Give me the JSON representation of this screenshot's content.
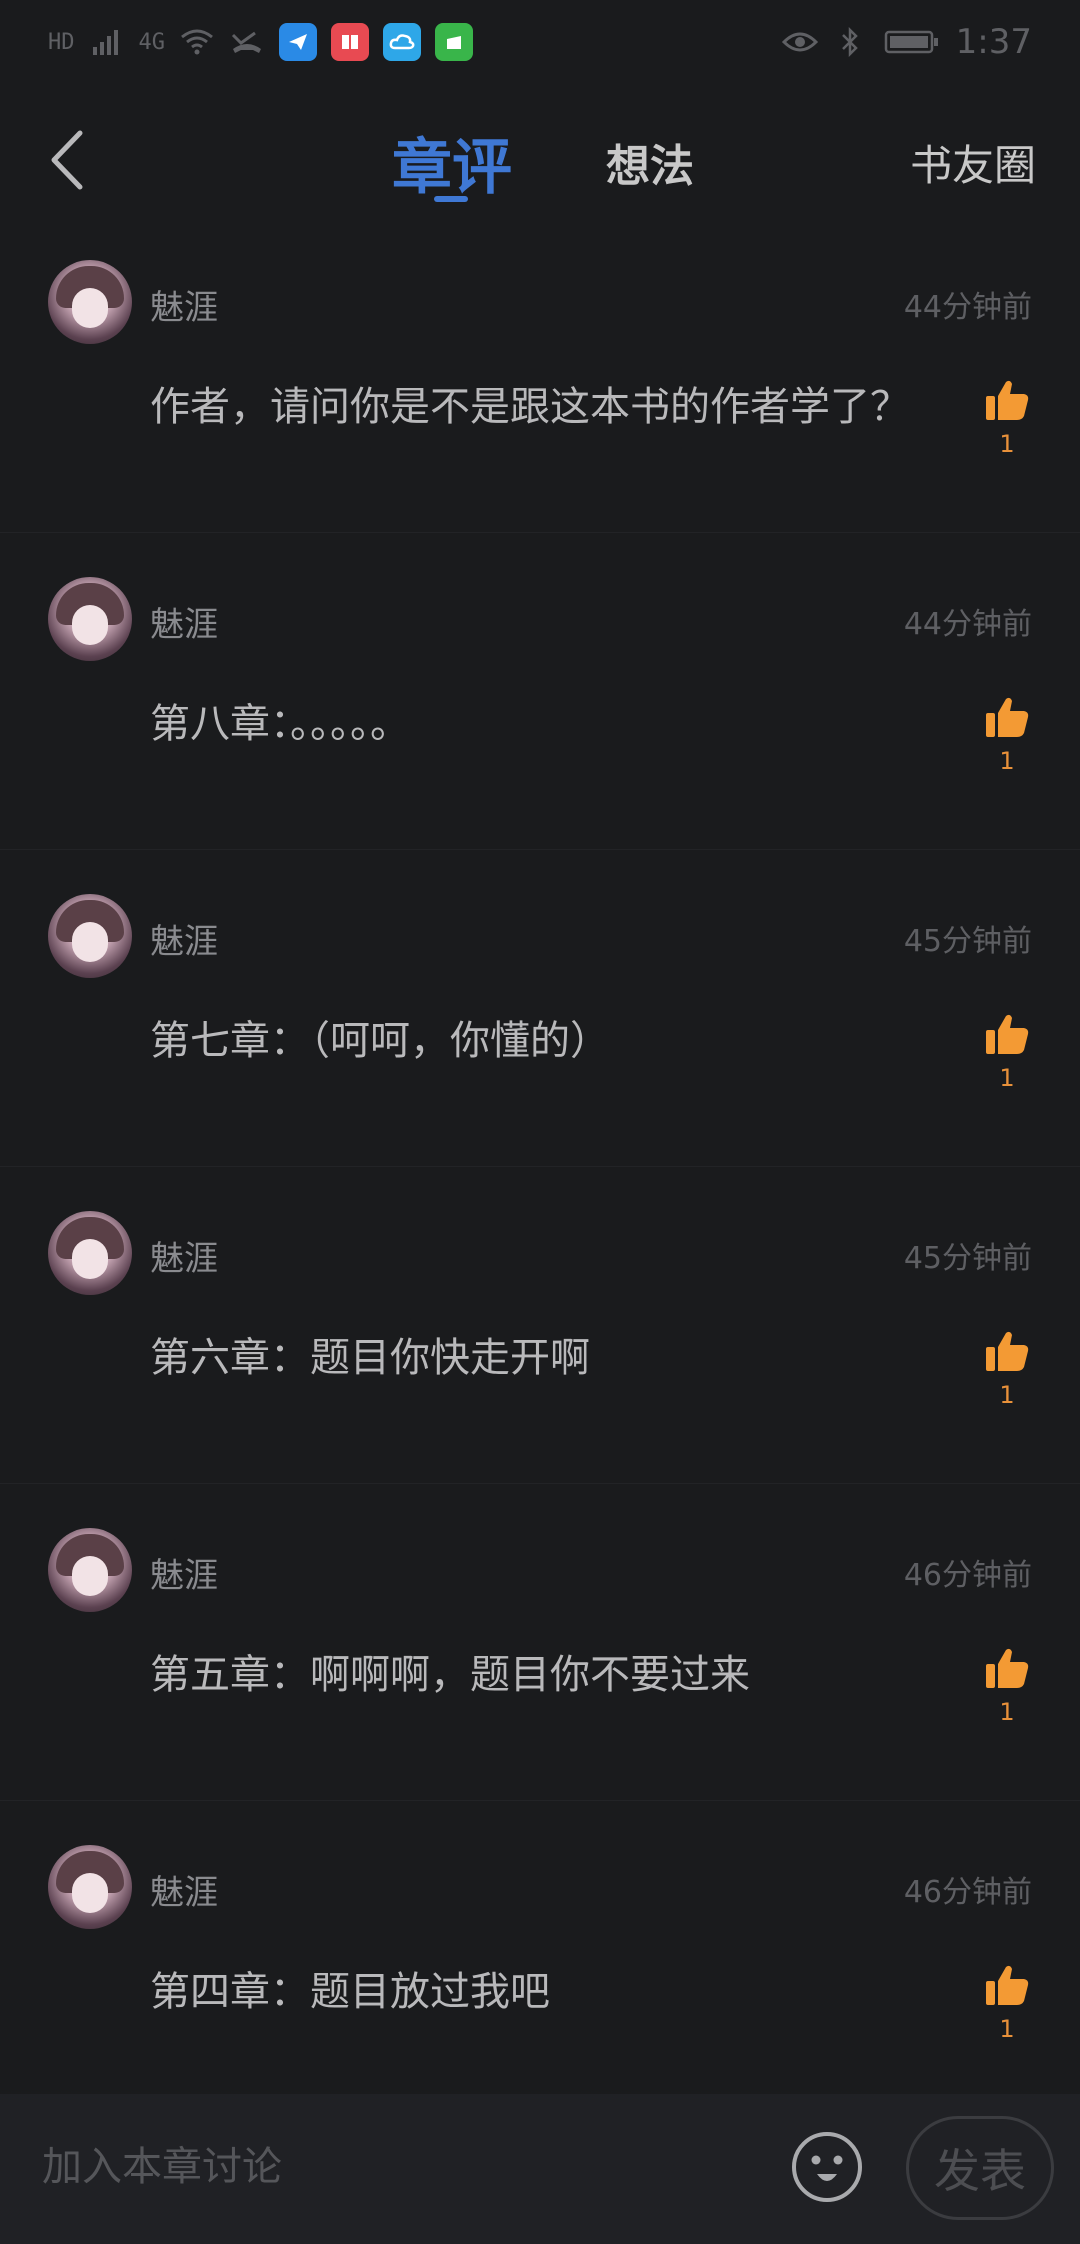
{
  "status_bar": {
    "left_icons": [
      "hd-icon",
      "signal-4g-icon",
      "wifi-icon",
      "missed-call-icon"
    ],
    "apps": [
      {
        "name": "app-fly-icon",
        "color": "#2a8ae6"
      },
      {
        "name": "app-book-icon",
        "color": "#e84a52"
      },
      {
        "name": "app-cloud-icon",
        "color": "#2ea7e8"
      },
      {
        "name": "app-clean-icon",
        "color": "#39b54a"
      }
    ],
    "hd_label": "HD",
    "net_label": "4G",
    "time": "1:37"
  },
  "header": {
    "tabs": [
      {
        "label": "章评",
        "active": true
      },
      {
        "label": "想法",
        "active": false
      }
    ],
    "right_link": "书友圈"
  },
  "comments": [
    {
      "user": "魅涯",
      "time": "44分钟前",
      "text": "作者，请问你是不是跟这本书的作者学了？",
      "likes": "1"
    },
    {
      "user": "魅涯",
      "time": "44分钟前",
      "text": "第八章：。。。。。",
      "likes": "1"
    },
    {
      "user": "魅涯",
      "time": "45分钟前",
      "text": "第七章：（呵呵，你懂的）",
      "likes": "1"
    },
    {
      "user": "魅涯",
      "time": "45分钟前",
      "text": "第六章：题目你快走开啊",
      "likes": "1"
    },
    {
      "user": "魅涯",
      "time": "46分钟前",
      "text": "第五章：啊啊啊，题目你不要过来",
      "likes": "1"
    },
    {
      "user": "魅涯",
      "time": "46分钟前",
      "text": "第四章：题目放过我吧",
      "likes": "1"
    }
  ],
  "bottom_bar": {
    "placeholder": "加入本章讨论",
    "publish_label": "发表"
  },
  "colors": {
    "background": "#1a1b1d",
    "accent": "#3f78d4",
    "like": "#f39a34"
  }
}
